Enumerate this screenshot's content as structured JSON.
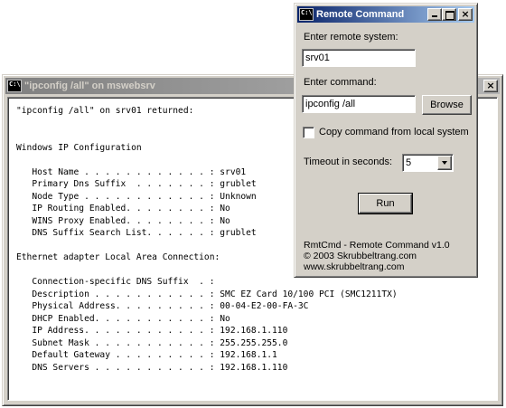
{
  "console_window": {
    "title": "\"ipconfig /all\" on mswebsrv",
    "icon": "console-icon",
    "output": "\"ipconfig /all\" on srv01 returned:\n\n\nWindows IP Configuration\n\n   Host Name . . . . . . . . . . . . : srv01\n   Primary Dns Suffix  . . . . . . . : grublet\n   Node Type . . . . . . . . . . . . : Unknown\n   IP Routing Enabled. . . . . . . . : No\n   WINS Proxy Enabled. . . . . . . . : No\n   DNS Suffix Search List. . . . . . : grublet\n\nEthernet adapter Local Area Connection:\n\n   Connection-specific DNS Suffix  . :\n   Description . . . . . . . . . . . : SMC EZ Card 10/100 PCI (SMC1211TX)\n   Physical Address. . . . . . . . . : 00-04-E2-00-FA-3C\n   DHCP Enabled. . . . . . . . . . . : No\n   IP Address. . . . . . . . . . . . : 192.168.1.110\n   Subnet Mask . . . . . . . . . . . : 255.255.255.0\n   Default Gateway . . . . . . . . . : 192.168.1.1\n   DNS Servers . . . . . . . . . . . : 192.168.1.110",
    "close_glyph": "×"
  },
  "remote_window": {
    "title": "Remote Command",
    "icon": "console-icon",
    "min_glyph": "",
    "max_glyph": "",
    "close_glyph": "×",
    "system_label": "Enter remote system:",
    "system_value": "srv01",
    "command_label": "Enter command:",
    "command_value": "ipconfig /all",
    "browse_label": "Browse",
    "copy_label": "Copy command from local system",
    "copy_checked": false,
    "timeout_label": "Timeout in seconds:",
    "timeout_value": "5",
    "run_label": "Run",
    "about_lines": [
      "RmtCmd - Remote Command v1.0",
      "© 2003 Skrubbeltrang.com",
      "www.skrubbeltrang.com"
    ]
  },
  "colors": {
    "active_title": "#0a246a",
    "inactive_title": "#808080",
    "face": "#d4d0c8"
  }
}
